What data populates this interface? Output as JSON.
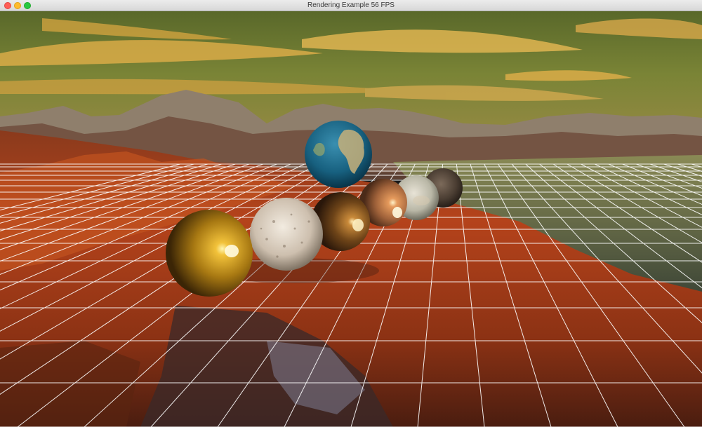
{
  "window": {
    "title": "Rendering Example 56 FPS"
  },
  "scene": {
    "objects": [
      "gold-metal-sphere",
      "speckled-stone-sphere",
      "bronze-metal-sphere",
      "earth-globe-sphere",
      "copper-metal-sphere",
      "marble-sphere",
      "dark-rock-sphere"
    ],
    "colors": {
      "sky": "#6f7a34",
      "clouds": "#e8b24a",
      "terrain": "#b5431b",
      "grid": "#ffffff"
    }
  }
}
